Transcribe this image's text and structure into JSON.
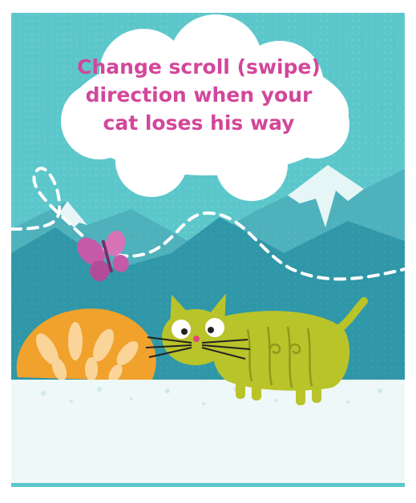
{
  "headline": "Change scroll (swipe) direction when your cat loses his way",
  "colors": {
    "sky": "#5cc7cb",
    "mountain_back": "#4eb1bc",
    "mountain_front": "#2f97a8",
    "snow_cap": "#e6f5f6",
    "ground": "#eef8f9",
    "cloud": "#ffffff",
    "headline_text": "#d2479a",
    "cat": "#b9c32a",
    "bush": "#f0a22c",
    "butterfly": "#c55aa8"
  },
  "illustration": {
    "subjects": [
      "cloud",
      "mountains",
      "dashed-path",
      "butterfly",
      "bush",
      "cat",
      "snowy-ground"
    ]
  }
}
